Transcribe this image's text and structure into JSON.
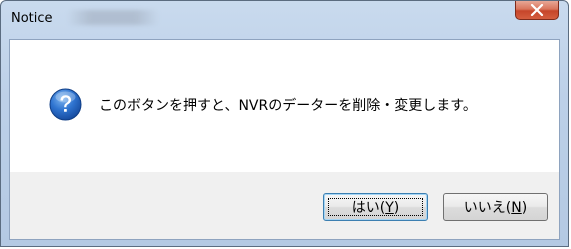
{
  "window": {
    "title": "Notice",
    "close_icon": "close-x-icon"
  },
  "dialog": {
    "icon": "question-icon",
    "message": "このボタンを押すと、NVRのデーターを削除・変更します。"
  },
  "buttons": {
    "yes": {
      "label_prefix": "はい(",
      "mnemonic": "Y",
      "label_suffix": ")"
    },
    "no": {
      "label_prefix": "いいえ(",
      "mnemonic": "N",
      "label_suffix": ")"
    }
  },
  "colors": {
    "icon_blue": "#1f5fbf",
    "close_red": "#c6452a"
  }
}
